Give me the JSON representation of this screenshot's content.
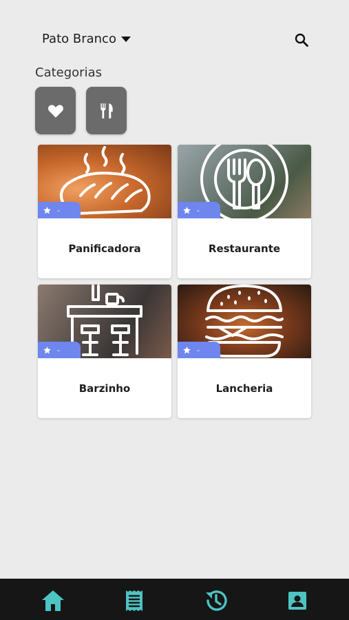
{
  "header": {
    "city": "Pato Branco",
    "city_icon": "caret-down-icon",
    "search_icon": "search-icon"
  },
  "categories": {
    "title": "Categorias",
    "filters": [
      {
        "icon": "heart-icon"
      },
      {
        "icon": "fork-knife-icon"
      }
    ]
  },
  "cards": [
    {
      "label": "Panificadora",
      "rating": "-",
      "icon": "bread-icon"
    },
    {
      "label": "Restaurante",
      "rating": "-",
      "icon": "plate-cutlery-icon"
    },
    {
      "label": "Barzinho",
      "rating": "-",
      "icon": "bar-counter-icon"
    },
    {
      "label": "Lancheria",
      "rating": "-",
      "icon": "burger-icon"
    }
  ],
  "bottom_nav": [
    {
      "icon": "home-icon"
    },
    {
      "icon": "receipt-icon"
    },
    {
      "icon": "history-icon"
    },
    {
      "icon": "contact-card-icon"
    }
  ],
  "colors": {
    "background": "#ebebeb",
    "accent": "#4ec3c3",
    "rating_badge": "#6f86ee",
    "filter_button": "#6b6b6b",
    "nav_bar": "#161616"
  }
}
